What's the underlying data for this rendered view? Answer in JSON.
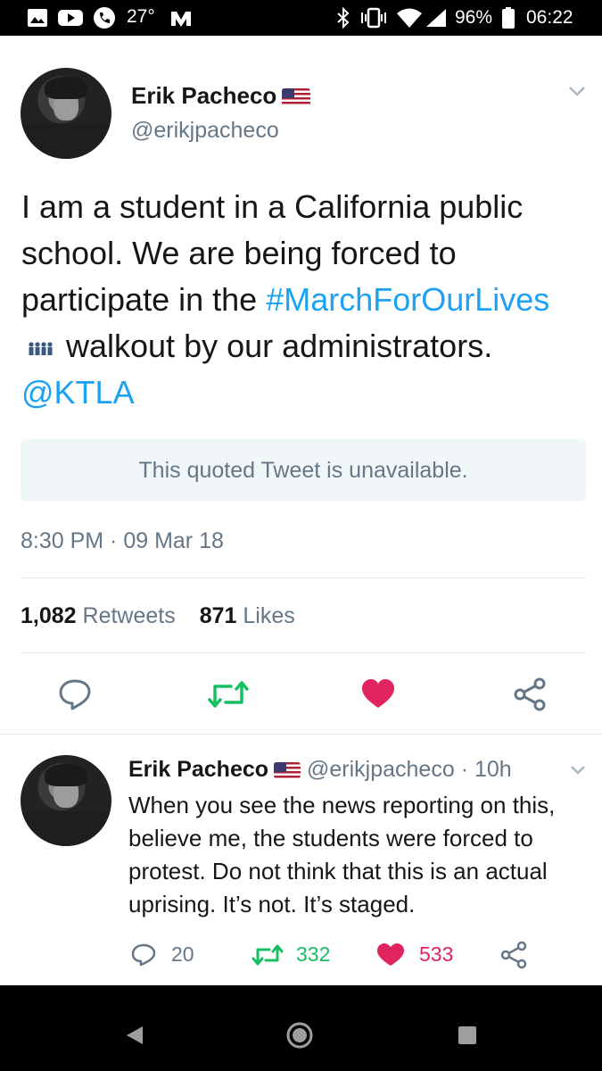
{
  "status_bar": {
    "temperature": "27°",
    "battery": "96%",
    "time": "06:22"
  },
  "tweet": {
    "author_name": "Erik Pacheco",
    "author_handle": "@erikjpacheco",
    "text_start": "I am a student in a California public school. We are being forced to participate in the",
    "hashtag": "#MarchForOurLives",
    "text_middle": "walkout by our administrators.",
    "mention": "@KTLA",
    "quoted_unavailable": "This quoted Tweet is unavailable.",
    "timestamp": "8:30 PM · 09 Mar 18",
    "retweet_count": "1,082",
    "retweet_label": "Retweets",
    "like_count": "871",
    "like_label": "Likes"
  },
  "reply": {
    "author_name": "Erik Pacheco",
    "author_handle": "@erikjpacheco",
    "time_sep": "·",
    "time": "10h",
    "text": "When you see the news reporting on this, believe me, the students were forced to protest. Do not think that this is an actual uprising. It’s not. It’s staged.",
    "reply_count": "20",
    "retweet_count": "332",
    "like_count": "533"
  },
  "colors": {
    "link": "#1da1f2",
    "retweet_green": "#17bf63",
    "like_red": "#e0245e",
    "muted": "#657786"
  },
  "icons": [
    "image-icon",
    "youtube-icon",
    "phone-icon",
    "app-icon",
    "bluetooth-icon",
    "vibrate-icon",
    "wifi-icon",
    "signal-icon",
    "battery-icon",
    "chevron-down-icon",
    "reply-icon",
    "retweet-icon",
    "heart-icon",
    "share-icon",
    "back-icon",
    "home-icon",
    "recents-icon"
  ]
}
